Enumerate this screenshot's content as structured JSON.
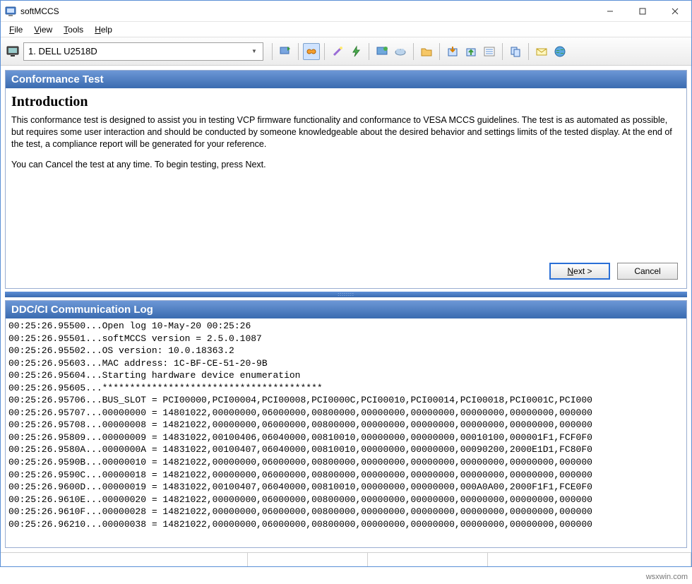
{
  "window": {
    "title": "softMCCS"
  },
  "menubar": {
    "file": "File",
    "view": "View",
    "tools": "Tools",
    "help": "Help"
  },
  "toolbar": {
    "display_selected": "1. DELL U2518D",
    "icons": [
      "monitor-icon",
      "refresh-icon",
      "link-icon",
      "wand-icon",
      "bolt-icon",
      "monitor2-icon",
      "cloud-icon",
      "folder-icon",
      "import-icon",
      "export-icon",
      "list-icon",
      "copy-icon",
      "mail-icon",
      "globe-icon"
    ]
  },
  "conformance": {
    "panel_title": "Conformance Test",
    "intro_title": "Introduction",
    "para1": "This conformance test is designed to assist you in testing VCP firmware functionality and conformance to VESA MCCS guidelines. The test is as automated as possible, but requires some user interaction and should be conducted by someone knowledgeable about the desired behavior and settings limits of the tested display. At the end of the test, a compliance report will be generated for your reference.",
    "para2": "You can Cancel the test at any time. To begin testing, press Next.",
    "next_label": "Next >",
    "cancel_label": "Cancel"
  },
  "log": {
    "panel_title": "DDC/CI Communication Log",
    "lines": [
      "00:25:26.95500...Open log 10-May-20 00:25:26",
      "00:25:26.95501...softMCCS version = 2.5.0.1087",
      "00:25:26.95502...OS version: 10.0.18363.2",
      "00:25:26.95603...MAC address: 1C-BF-CE-51-20-9B",
      "00:25:26.95604...Starting hardware device enumeration",
      "00:25:26.95605...****************************************",
      "00:25:26.95706...BUS_SLOT = PCI00000,PCI00004,PCI00008,PCI0000C,PCI00010,PCI00014,PCI00018,PCI0001C,PCI000",
      "00:25:26.95707...00000000 = 14801022,00000000,06000000,00800000,00000000,00000000,00000000,00000000,000000",
      "00:25:26.95708...00000008 = 14821022,00000000,06000000,00800000,00000000,00000000,00000000,00000000,000000",
      "00:25:26.95809...00000009 = 14831022,00100406,06040000,00810010,00000000,00000000,00010100,000001F1,FCF0F0",
      "00:25:26.9580A...0000000A = 14831022,00100407,06040000,00810010,00000000,00000000,00090200,2000E1D1,FC80F0",
      "00:25:26.9590B...00000010 = 14821022,00000000,06000000,00800000,00000000,00000000,00000000,00000000,000000",
      "00:25:26.9590C...00000018 = 14821022,00000000,06000000,00800000,00000000,00000000,00000000,00000000,000000",
      "00:25:26.9600D...00000019 = 14831022,00100407,06040000,00810010,00000000,00000000,000A0A00,2000F1F1,FCE0F0",
      "00:25:26.9610E...00000020 = 14821022,00000000,06000000,00800000,00000000,00000000,00000000,00000000,000000",
      "00:25:26.9610F...00000028 = 14821022,00000000,06000000,00800000,00000000,00000000,00000000,00000000,000000",
      "00:25:26.96210...00000038 = 14821022,00000000,06000000,00800000,00000000,00000000,00000000,00000000,000000"
    ]
  },
  "watermark": "wsxwin.com"
}
